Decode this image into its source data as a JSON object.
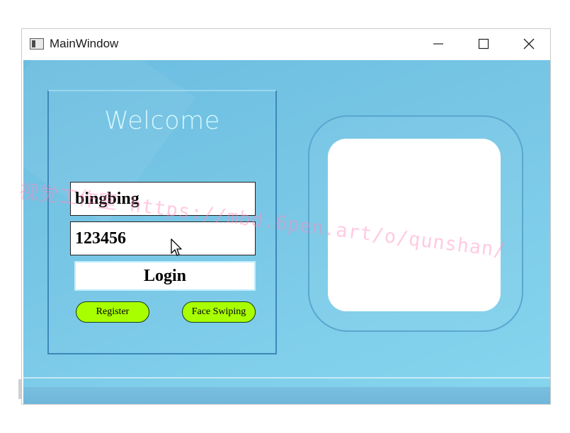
{
  "window": {
    "title": "MainWindow",
    "controls": {
      "minimize": "—",
      "maximize": "☐",
      "close": "✕"
    }
  },
  "login": {
    "heading": "Welcome",
    "username_value": "bingbing",
    "password_value": "123456",
    "login_label": "Login",
    "register_label": "Register",
    "face_label": "Face Swiping"
  },
  "watermark": "视觉工作室  https://mbd.6pen.art/o/qunshan/",
  "colors": {
    "client_bg": "#79c7e6",
    "pill_button": "#a8ff00",
    "welcome_text": "#d6f7ff",
    "face_box": "#ffffff"
  },
  "icons": [
    "app-window-icon",
    "minimize-icon",
    "maximize-icon",
    "close-icon",
    "mouse-cursor-icon"
  ]
}
